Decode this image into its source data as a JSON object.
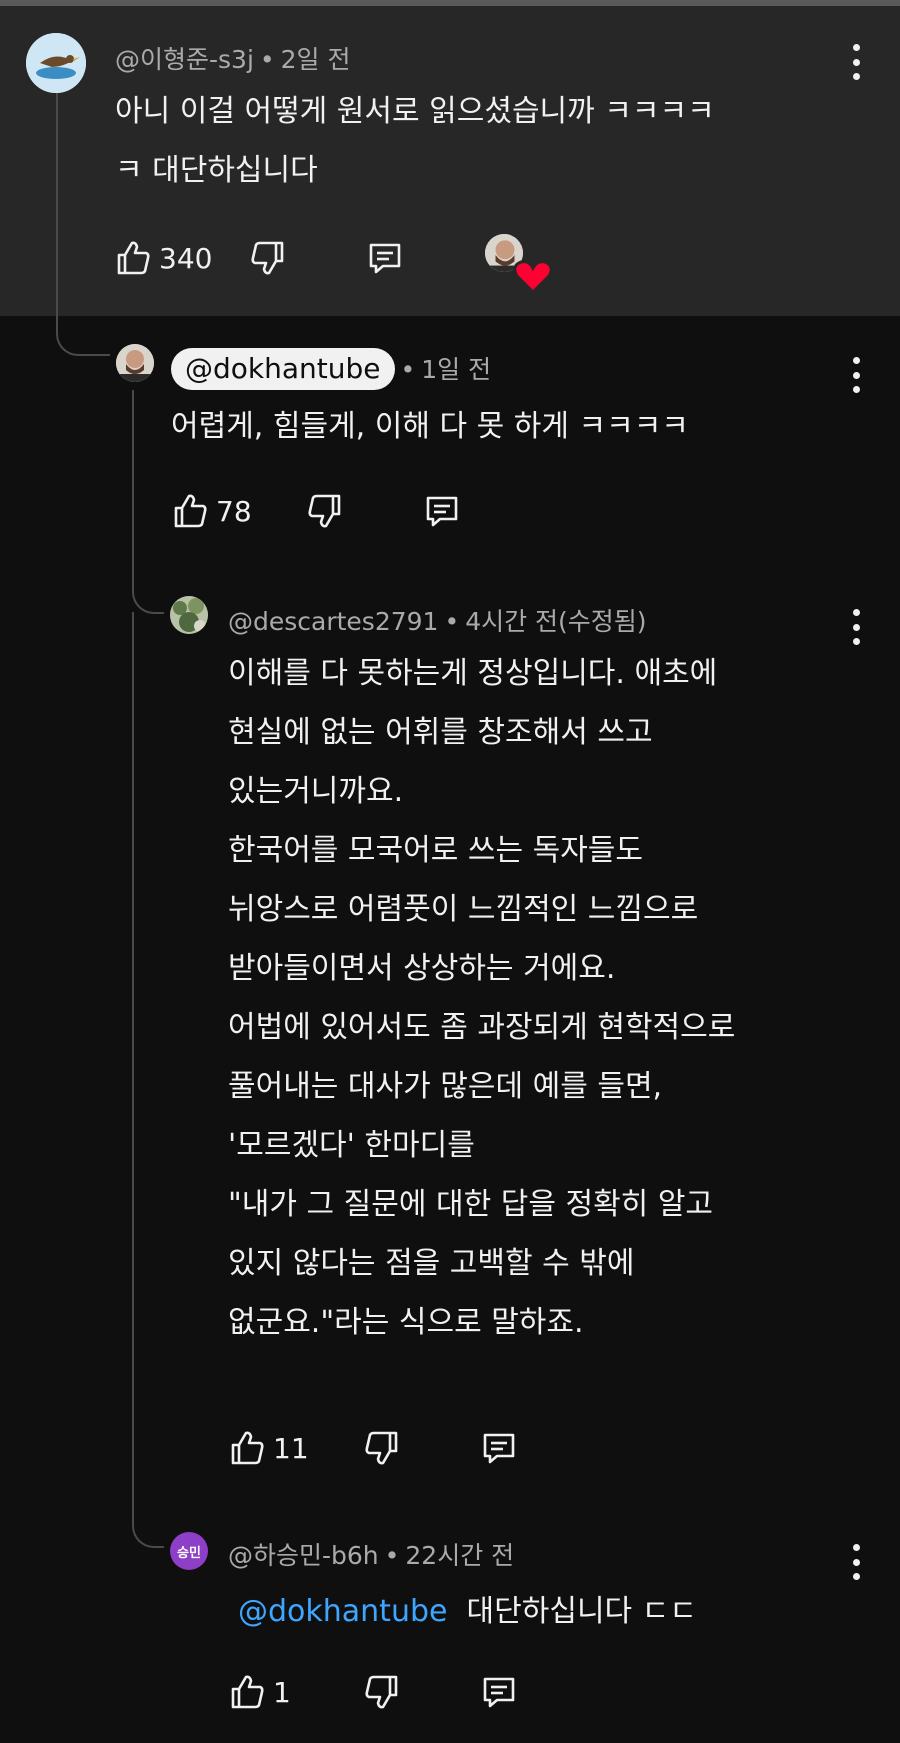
{
  "comments": [
    {
      "author": "@이형준-s3j",
      "time": "2일 전",
      "lines": [
        "아니 이걸 어떻게 원서로 읽으셨습니까 ㅋㅋㅋㅋ",
        "ㅋ 대단하십니다"
      ],
      "likes": "340",
      "avatar_icon": "seabird-avatar-icon"
    },
    {
      "author": "@dokhantube",
      "time": "1일 전",
      "lines": [
        "어렵게, 힘들게, 이해 다 못 하게 ㅋㅋㅋㅋ"
      ],
      "likes": "78",
      "avatar_icon": "bald-man-avatar-icon"
    },
    {
      "author": "@descartes2791",
      "time": "4시간 전(수정됨)",
      "lines": [
        "이해를 다 못하는게 정상입니다. 애초에",
        "현실에 없는 어휘를 창조해서 쓰고",
        "있는거니까요.",
        "한국어를 모국어로 쓰는 독자들도",
        "뉘앙스로 어렴풋이 느낌적인 느낌으로",
        "받아들이면서 상상하는 거에요.",
        "어법에 있어서도 좀 과장되게 현학적으로",
        "풀어내는 대사가 많은데 예를 들면,",
        "'모르겠다' 한마디를",
        "\"내가 그 질문에 대한 답을 정확히 알고",
        "있지 않다는 점을 고백할 수 밖에",
        "없군요.\"라는 식으로 말하죠."
      ],
      "likes": "11",
      "avatar_icon": "plant-photo-avatar-icon"
    },
    {
      "author": "@하승민-b6h",
      "time": "22시간 전",
      "mention": "@dokhantube",
      "text": "대단하십니다 ㄷㄷ",
      "likes": "1",
      "avatar_text": "승민",
      "avatar_icon": "purple-initials-avatar-icon"
    }
  ],
  "colors": {
    "background": "#0f0f0f",
    "highlighted_comment_bg": "#272727",
    "mention": "#3ea6ff",
    "avatar_purple": "#8e3fc8",
    "heart": "#ff0033"
  }
}
